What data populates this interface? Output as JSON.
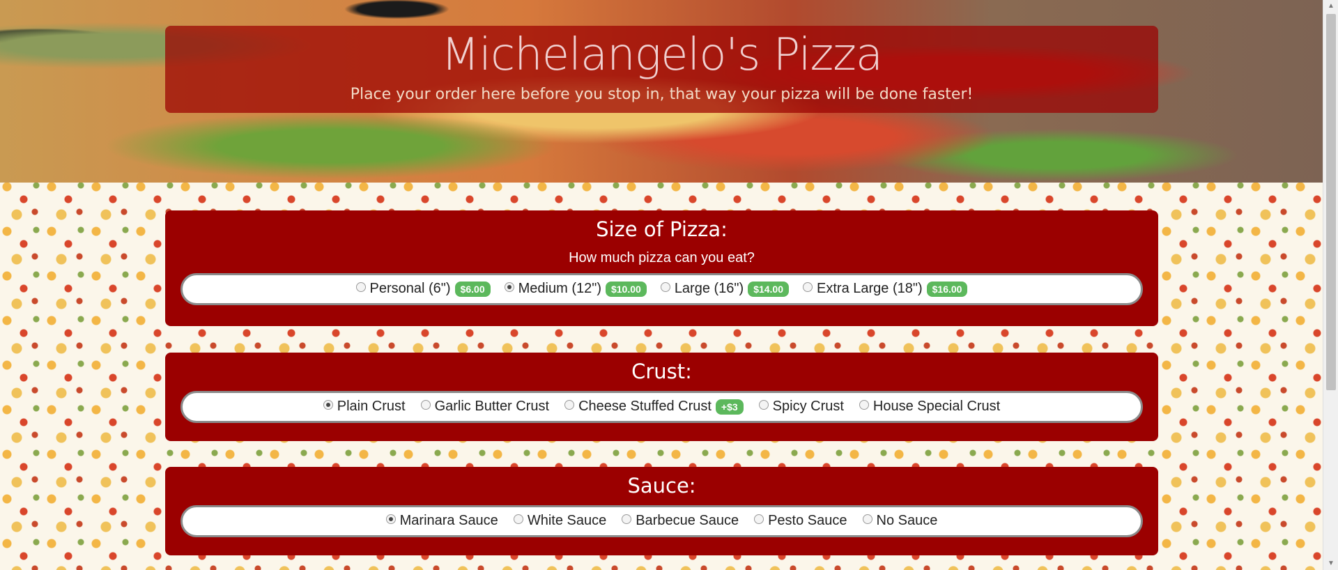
{
  "header": {
    "title": "Michelangelo's Pizza",
    "subtitle": "Place your order here before you stop in, that way your pizza will be done faster!"
  },
  "size": {
    "title": "Size of Pizza:",
    "question": "How much pizza can you eat?",
    "options": [
      {
        "label": "Personal (6\")",
        "price": "$6.00",
        "checked": false
      },
      {
        "label": "Medium (12\")",
        "price": "$10.00",
        "checked": true
      },
      {
        "label": "Large (16\")",
        "price": "$14.00",
        "checked": false
      },
      {
        "label": "Extra Large (18\")",
        "price": "$16.00",
        "checked": false
      }
    ]
  },
  "crust": {
    "title": "Crust:",
    "options": [
      {
        "label": "Plain Crust",
        "checked": true
      },
      {
        "label": "Garlic Butter Crust",
        "checked": false
      },
      {
        "label": "Cheese Stuffed Crust",
        "price": "+$3",
        "checked": false
      },
      {
        "label": "Spicy Crust",
        "checked": false
      },
      {
        "label": "House Special Crust",
        "checked": false
      }
    ]
  },
  "sauce": {
    "title": "Sauce:",
    "options": [
      {
        "label": "Marinara Sauce",
        "checked": true
      },
      {
        "label": "White Sauce",
        "checked": false
      },
      {
        "label": "Barbecue Sauce",
        "checked": false
      },
      {
        "label": "Pesto Sauce",
        "checked": false
      },
      {
        "label": "No Sauce",
        "checked": false
      }
    ]
  },
  "colors": {
    "panel": "#9b0000",
    "badge": "#5cb85c"
  }
}
